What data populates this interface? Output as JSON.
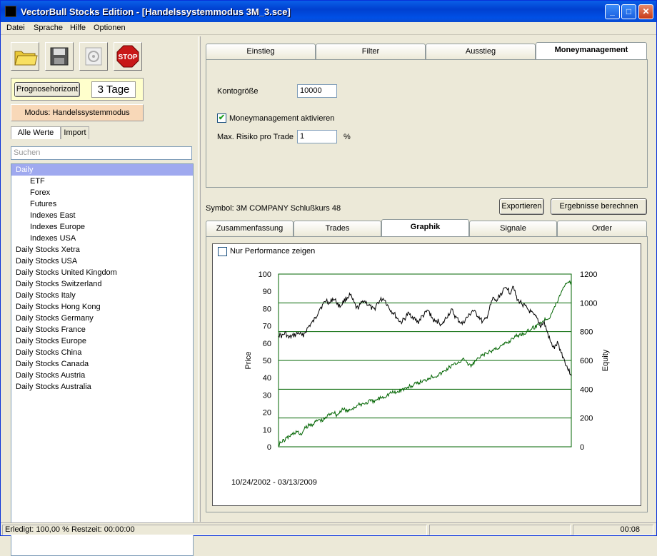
{
  "window": {
    "title": "VectorBull Stocks Edition - [Handelssystemmodus 3M_3.sce]",
    "minimize": "_",
    "maximize": "□",
    "close": "✕"
  },
  "menu": [
    "Datei",
    "Sprache",
    "Hilfe",
    "Optionen"
  ],
  "toolbar": {
    "stop_label": "STOP"
  },
  "prognose": {
    "button_label": "Prognosehorizont",
    "value": "3 Tage"
  },
  "modus": "Modus: Handelssystemmodus",
  "left_tabs": [
    "Alle Werte",
    "Import"
  ],
  "search": {
    "placeholder": "Suchen"
  },
  "tree": [
    {
      "label": "Daily",
      "level": 0,
      "selected": true
    },
    {
      "label": "ETF",
      "level": 1
    },
    {
      "label": "Forex",
      "level": 1
    },
    {
      "label": "Futures",
      "level": 1
    },
    {
      "label": "Indexes East",
      "level": 1
    },
    {
      "label": "Indexes Europe",
      "level": 1
    },
    {
      "label": "Indexes USA",
      "level": 1
    },
    {
      "label": "Daily Stocks Xetra",
      "level": 0
    },
    {
      "label": "Daily Stocks USA",
      "level": 0
    },
    {
      "label": "Daily Stocks United Kingdom",
      "level": 0
    },
    {
      "label": "Daily Stocks Switzerland",
      "level": 0
    },
    {
      "label": "Daily Stocks Italy",
      "level": 0
    },
    {
      "label": "Daily Stocks Hong Kong",
      "level": 0
    },
    {
      "label": "Daily Stocks Germany",
      "level": 0
    },
    {
      "label": "Daily Stocks France",
      "level": 0
    },
    {
      "label": "Daily Stocks Europe",
      "level": 0
    },
    {
      "label": "Daily Stocks China",
      "level": 0
    },
    {
      "label": "Daily Stocks Canada",
      "level": 0
    },
    {
      "label": "Daily Stocks Austria",
      "level": 0
    },
    {
      "label": "Daily Stocks Australia",
      "level": 0
    }
  ],
  "top_tabs": [
    "Einstieg",
    "Filter",
    "Ausstieg",
    "Moneymanagement"
  ],
  "money": {
    "konto_label": "Kontogröße",
    "konto_value": "10000",
    "mm_label": "Moneymanagement aktivieren",
    "mm_checked": true,
    "risk_label": "Max. Risiko pro Trade",
    "risk_value": "1",
    "risk_unit": "%"
  },
  "symbol_text": "Symbol: 3M COMPANY Schlußkurs  48",
  "buttons": {
    "export": "Exportieren",
    "calc": "Ergebnisse berechnen"
  },
  "bottom_tabs": [
    "Zusammenfassung",
    "Trades",
    "Graphik",
    "Signale",
    "Order"
  ],
  "perf_label": "Nur Performance zeigen",
  "date_range": "10/24/2002 - 03/13/2009",
  "status": {
    "left": "Erledigt: 100,00 %  Restzeit: 00:00:00",
    "right": "00:08"
  },
  "chart_data": {
    "type": "line",
    "ylabel": "Price",
    "y2label": "Equity",
    "ylim": [
      0,
      100
    ],
    "y2lim": [
      0,
      1200
    ],
    "yticks": [
      0,
      10,
      20,
      30,
      40,
      50,
      60,
      70,
      80,
      90,
      100
    ],
    "y2ticks": [
      0,
      200,
      400,
      600,
      800,
      1000,
      1200
    ],
    "grid": true,
    "series": [
      {
        "axis": "left",
        "color": "#000000",
        "values": [
          65,
          64,
          66,
          63,
          64,
          65,
          66,
          64,
          67,
          70,
          72,
          75,
          80,
          82,
          85,
          83,
          86,
          84,
          81,
          84,
          86,
          88,
          84,
          80,
          82,
          85,
          83,
          81,
          79,
          83,
          85,
          86,
          82,
          79,
          77,
          74,
          72,
          74,
          77,
          76,
          74,
          72,
          75,
          77,
          79,
          75,
          72,
          73,
          70,
          74,
          77,
          79,
          75,
          73,
          71,
          74,
          76,
          79,
          77,
          75,
          72,
          74,
          80,
          86,
          84,
          88,
          90,
          93,
          89,
          94,
          85,
          84,
          82,
          80,
          78,
          76,
          74,
          70,
          72,
          66,
          60,
          57,
          60,
          55,
          50,
          45,
          42
        ]
      },
      {
        "axis": "right",
        "color": "#006400",
        "values": [
          20,
          35,
          55,
          75,
          90,
          110,
          80,
          120,
          145,
          155,
          170,
          190,
          180,
          205,
          230,
          245,
          220,
          250,
          260,
          245,
          265,
          280,
          290,
          300,
          305,
          320,
          310,
          330,
          345,
          350,
          365,
          380,
          375,
          390,
          400,
          410,
          420,
          430,
          440,
          455,
          460,
          480,
          490,
          495,
          505,
          520,
          540,
          560,
          570,
          590,
          600,
          610,
          560,
          570,
          600,
          620,
          640,
          650,
          660,
          680,
          690,
          700,
          720,
          730,
          760,
          770,
          780,
          790,
          800,
          820,
          830,
          850,
          870,
          890,
          900,
          950,
          1000,
          1060,
          1120,
          1150,
          1140
        ]
      }
    ]
  }
}
